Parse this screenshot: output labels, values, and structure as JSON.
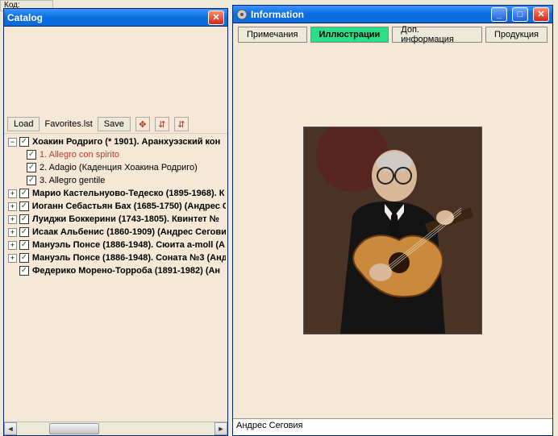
{
  "bg_label": "Код:",
  "catalog": {
    "title": "Catalog",
    "load": "Load",
    "favfile": "Favorites.lst",
    "save": "Save",
    "tree": {
      "root": "Хоакин Родриго (* 1901). Аранхуэзский кон",
      "child1": "1. Allegro con spirito",
      "child2": "2. Adagio (Каденция Хоакина Родриго)",
      "child3": "3. Allegro gentile",
      "n1": "Марио Кастельнуово-Тедеско (1895-1968). К",
      "n2": "Иоганн Себастьян Бах (1685-1750) (Андрес С",
      "n3": "Луиджи Боккерини (1743-1805). Квинтет №",
      "n4": "Исаак Альбенис (1860-1909) (Андрес Сегови",
      "n5": "Мануэль Понсе (1886-1948). Сюита a-moll (А",
      "n6": "Мануэль Понсе (1886-1948). Соната №3 (Анд",
      "n7": "Федерико Морено-Торроба (1891-1982) (Ан"
    }
  },
  "info": {
    "title": "Information",
    "tabs": {
      "notes": "Примечания",
      "illus": "Иллюстрации",
      "extra": "Доп. информация",
      "prod": "Продукция"
    },
    "caption": "Андрес Сеговия"
  }
}
